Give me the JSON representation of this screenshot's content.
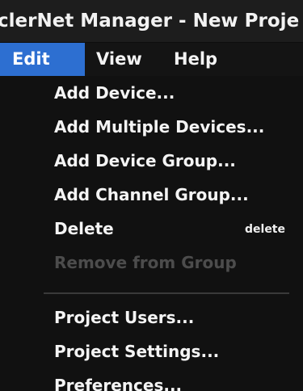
{
  "window": {
    "title": "clerNet Manager - New Proje"
  },
  "menubar": {
    "items": [
      {
        "label": "Edit"
      },
      {
        "label": "View"
      },
      {
        "label": "Help"
      }
    ]
  },
  "edit_menu": {
    "items": [
      {
        "label": "Add Device...",
        "shortcut": ""
      },
      {
        "label": "Add Multiple Devices...",
        "shortcut": ""
      },
      {
        "label": "Add Device Group...",
        "shortcut": ""
      },
      {
        "label": "Add Channel Group...",
        "shortcut": ""
      },
      {
        "label": "Delete",
        "shortcut": "delete"
      },
      {
        "label": "Remove from Group",
        "shortcut": ""
      },
      {
        "label": "Project Users...",
        "shortcut": ""
      },
      {
        "label": "Project Settings...",
        "shortcut": ""
      },
      {
        "label": "Preferences...",
        "shortcut": ""
      }
    ]
  },
  "colors": {
    "accent": "#2d6fd1",
    "disabled_text": "#4c4c4c"
  }
}
